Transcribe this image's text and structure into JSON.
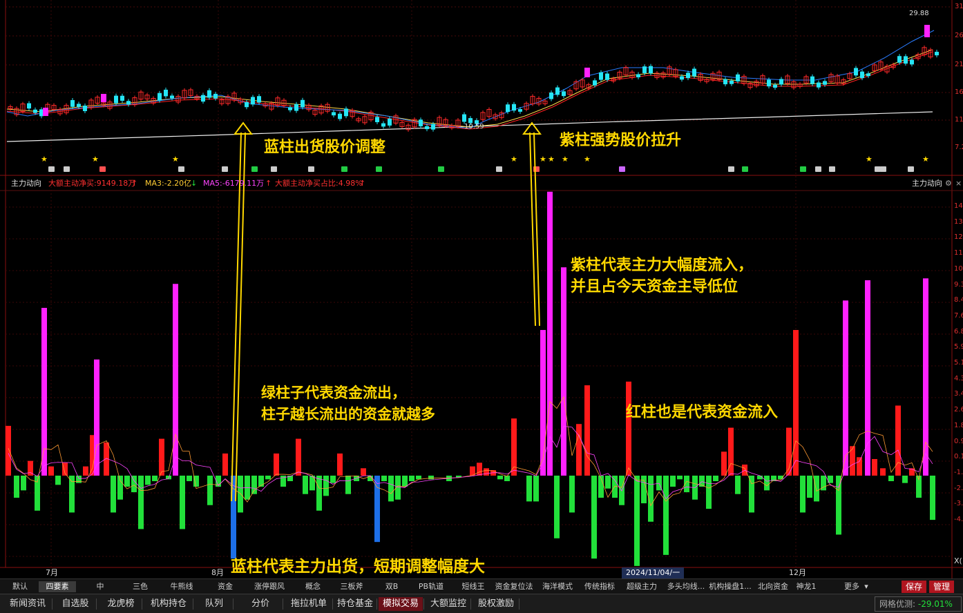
{
  "indicator": {
    "name": "主力动向",
    "right_name": "主力动向",
    "net_buy": "大额主动净买:9149.18万",
    "ma3": "MA3:-2.20亿",
    "ma5": "MA5:-6179.11万",
    "ratio": "大额主动净买占比:4.98%"
  },
  "price": {
    "high_label": "29.88",
    "low_label": "10.59"
  },
  "axis": {
    "price_ticks": [
      "31",
      "26",
      "21",
      "16",
      "11",
      "7.2"
    ],
    "ind_ticks": [
      "14",
      "13",
      "12",
      "11",
      "10",
      "9.3",
      "8.4",
      "7.6",
      "6.8",
      "5.9",
      "5.1",
      "4.3",
      "3.4",
      "2.6",
      "1.8",
      "0.9",
      "0.1",
      "-1.",
      "-2.",
      "-3.",
      "-4."
    ],
    "x_unit": "X(",
    "months": [
      "7月",
      "8月",
      "12月"
    ],
    "cursor_date": "2024/11/04/一"
  },
  "annotations": {
    "blue_sell": "蓝柱出货股价调整",
    "purple_strong": "紫柱强势股价拉升",
    "purple_inflow_1": "紫柱代表主力大幅度流入，",
    "purple_inflow_2": "并且占今天资金主导低位",
    "green_outflow_1": "绿柱子代表资金流出，",
    "green_outflow_2": "柱子越长流出的资金就越多",
    "red_inflow": "红柱也是代表资金流入",
    "blue_bottom": "蓝柱代表主力出货，短期调整幅度大"
  },
  "tabs": [
    "默认",
    "四要素",
    "中",
    "三色",
    "牛熊线",
    "资金",
    "涨停跟风",
    "概念",
    "三板斧",
    "双B",
    "PB轨道",
    "短线王",
    "资金复位法",
    "海洋模式",
    "传统指标",
    "超级主力",
    "多头均线...",
    "机构操盘1...",
    "北向资金",
    "神龙1",
    "更多"
  ],
  "tab_buttons": {
    "save": "保存",
    "manage": "管理"
  },
  "nav": [
    "新闻资讯",
    "自选股",
    "龙虎榜",
    "机构持仓",
    "队列",
    "分价",
    "拖拉机单",
    "持仓基金",
    "模拟交易",
    "大额监控",
    "股权激励"
  ],
  "status": {
    "label": "网格优测:",
    "value": "-29.01%"
  },
  "colors": {
    "red": "#ff1a1a",
    "green": "#22e03a",
    "magenta": "#ff22ff",
    "blue": "#1d6fe8",
    "cyan": "#25e5f5",
    "yellow": "#ffd800"
  }
}
